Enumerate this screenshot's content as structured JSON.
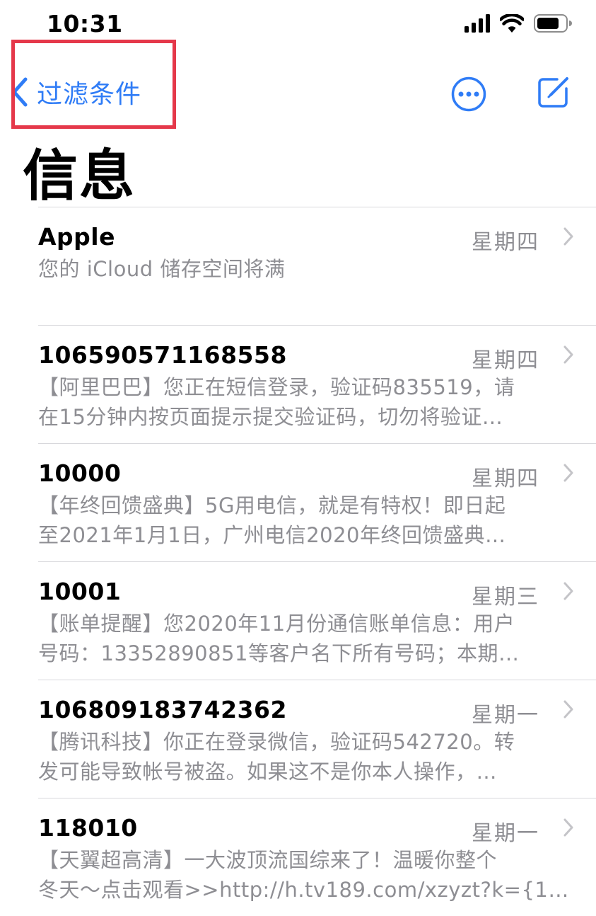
{
  "status_bar": {
    "time": "10:31"
  },
  "nav": {
    "back_label": "过滤条件"
  },
  "page": {
    "title": "信息"
  },
  "colors": {
    "accent": "#2f7cf6",
    "secondary_text": "#8e8e93",
    "highlight": "#e5384a",
    "separator": "#d8d8dc"
  },
  "icons": {
    "back": "chevron-left-icon",
    "more": "ellipsis-circle-icon",
    "compose": "compose-icon",
    "disclosure": "chevron-right-icon"
  },
  "messages": [
    {
      "sender": "Apple",
      "date": "星期四",
      "preview": [
        "您的 iCloud 储存空间将满",
        ""
      ]
    },
    {
      "sender": "106590571168558",
      "date": "星期四",
      "preview": [
        "【阿里巴巴】您正在短信登录，验证码835519，请",
        "在15分钟内按页面提示提交验证码，切勿将验证…"
      ]
    },
    {
      "sender": "10000",
      "date": "星期四",
      "preview": [
        "【年终回馈盛典】5G用电信，就是有特权！即日起",
        "至2021年1月1日，广州电信2020年终回馈盛典…"
      ]
    },
    {
      "sender": "10001",
      "date": "星期三",
      "preview": [
        "【账单提醒】您2020年11月份通信账单信息：用户",
        "号码：13352890851等客户名下所有号码；本期…"
      ]
    },
    {
      "sender": "106809183742362",
      "date": "星期一",
      "preview": [
        "【腾讯科技】你正在登录微信，验证码542720。转",
        "发可能导致帐号被盗。如果这不是你本人操作，…"
      ]
    },
    {
      "sender": "118010",
      "date": "星期一",
      "preview": [
        "【天翼超高清】一大波顶流国综来了！温暖你整个",
        "冬天～点击观看>>http://h.tv189.com/xzyzt?k={1}…"
      ]
    }
  ]
}
